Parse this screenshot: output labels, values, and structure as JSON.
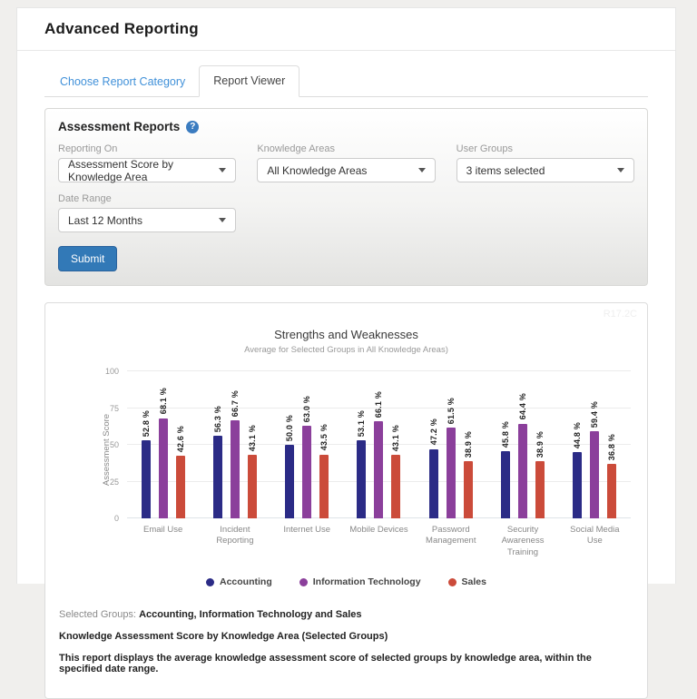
{
  "page": {
    "title": "Advanced Reporting"
  },
  "tabs": {
    "category": {
      "label": "Choose Report Category"
    },
    "viewer": {
      "label": "Report Viewer"
    }
  },
  "form": {
    "heading": "Assessment Reports",
    "help_icon_glyph": "?",
    "fields": [
      {
        "label": "Reporting On",
        "value": "Assessment Score by Knowledge Area"
      },
      {
        "label": "Knowledge Areas",
        "value": "All Knowledge Areas"
      },
      {
        "label": "User Groups",
        "value": "3 items selected"
      },
      {
        "label": "Date Range",
        "value": "Last 12 Months"
      }
    ],
    "submit_label": "Submit"
  },
  "report": {
    "watermark": "R17.2C",
    "footer": {
      "selected_groups_label": "Selected Groups:",
      "selected_groups_value": "Accounting, Information Technology and Sales",
      "report_title": "Knowledge Assessment Score by Knowledge Area (Selected Groups)",
      "report_description": "This report displays the average knowledge assessment score of selected groups by knowledge area, within the specified date range."
    }
  },
  "chart_data": {
    "type": "bar",
    "title": "Strengths and Weaknesses",
    "subtitle": "Average for Selected Groups in All Knowledge Areas)",
    "xlabel": "",
    "ylabel": "Assessment Score",
    "ylim": [
      0,
      100
    ],
    "yticks": [
      0,
      25,
      50,
      75,
      100
    ],
    "grid": true,
    "legend_position": "bottom",
    "categories": [
      "Email Use",
      "Incident Reporting",
      "Internet Use",
      "Mobile Devices",
      "Password Management",
      "Security Awareness Training",
      "Social Media Use"
    ],
    "series": [
      {
        "name": "Accounting",
        "color": "#2b2b86",
        "values": [
          52.8,
          56.3,
          50.0,
          53.1,
          47.2,
          45.8,
          44.8
        ],
        "labels": [
          "52.8 %",
          "56.3 %",
          "50.0 %",
          "53.1 %",
          "47.2 %",
          "45.8 %",
          "44.8 %"
        ]
      },
      {
        "name": "Information Technology",
        "color": "#8b3f9b",
        "values": [
          68.1,
          66.7,
          63.0,
          66.1,
          61.5,
          64.4,
          59.4
        ],
        "labels": [
          "68.1 %",
          "66.7 %",
          "63.0 %",
          "66.1 %",
          "61.5 %",
          "64.4 %",
          "59.4 %"
        ]
      },
      {
        "name": "Sales",
        "color": "#cb4b3a",
        "values": [
          42.6,
          43.1,
          43.5,
          43.1,
          38.9,
          38.9,
          36.8
        ],
        "labels": [
          "42.6 %",
          "43.1 %",
          "43.5 %",
          "43.1 %",
          "38.9 %",
          "38.9 %",
          "36.8 %"
        ]
      }
    ]
  },
  "colors": {
    "link_blue": "#4191d9",
    "button_blue": "#3279b7",
    "help_icon_blue": "#3b7cc0"
  }
}
